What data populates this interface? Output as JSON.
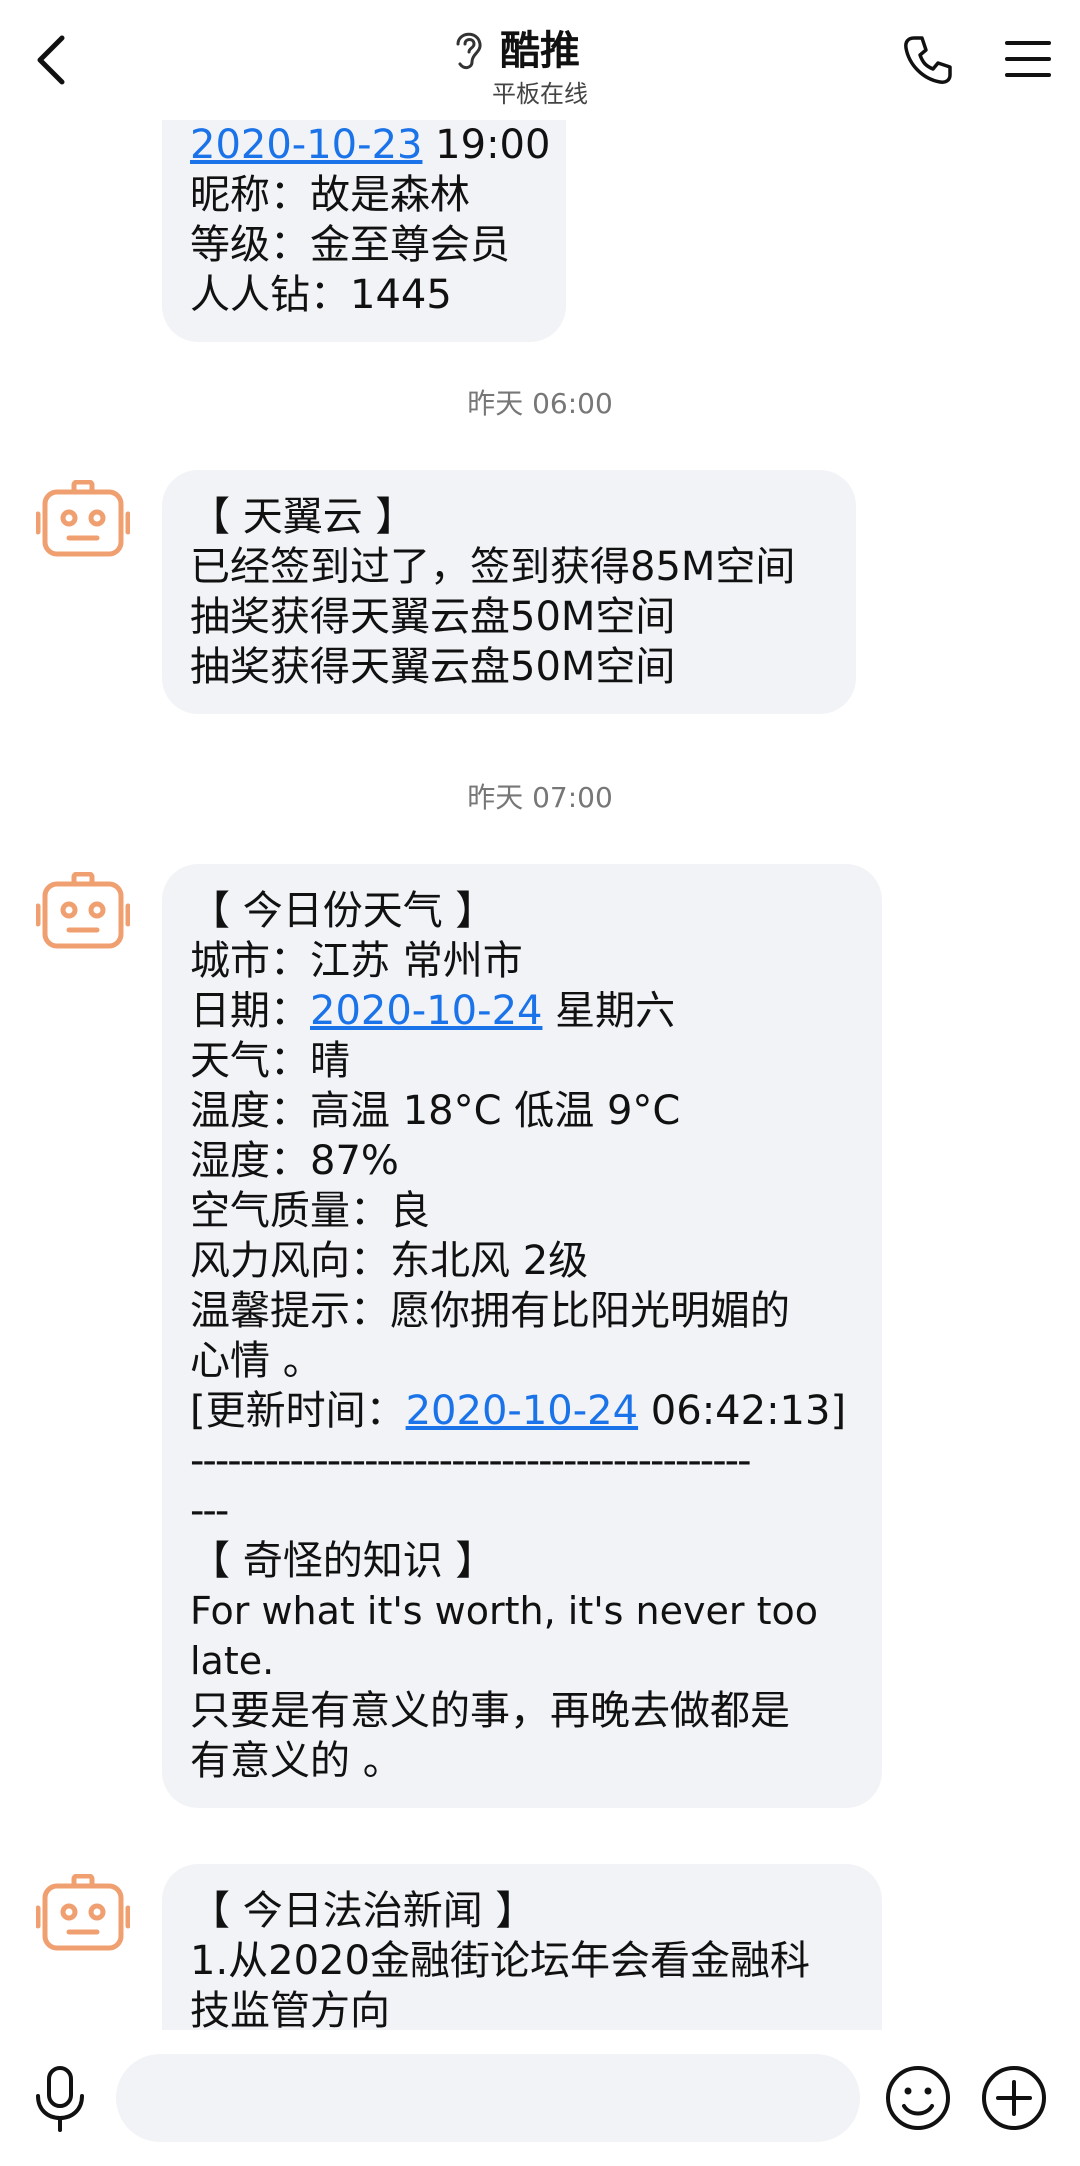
{
  "header": {
    "title": "酷推",
    "subtitle": "平板在线"
  },
  "messages": [
    {
      "lines_partial": [
        {
          "link": "2020-10-23",
          "text": " 19:00"
        },
        {
          "text": "昵称：故是森林"
        },
        {
          "text": "等级：金至尊会员"
        },
        {
          "text": "人人钻：1445"
        }
      ]
    }
  ],
  "timestamps": [
    "昨天 06:00",
    "昨天 07:00"
  ],
  "tianyi": {
    "line1": "【 天翼云 】",
    "line2": "已经签到过了，签到获得85M空间",
    "line3": "抽奖获得天翼云盘50M空间",
    "line4": "抽奖获得天翼云盘50M空间"
  },
  "weather": {
    "header": "【 今日份天气 】",
    "city": "城市：江苏 常州市",
    "date_prefix": "日期：",
    "date_link": "2020-10-24",
    "date_suffix": " 星期六",
    "weather": "天气：晴",
    "temp": "温度：高温 18°C 低温 9°C",
    "humidity": "湿度：87%",
    "air": "空气质量：良",
    "wind": "风力风向：东北风 2级",
    "tip1": "温馨提示：愿你拥有比阳光明媚的",
    "tip2": "心情 。",
    "update_prefix": "[更新时间：",
    "update_link": "2020-10-24",
    "update_suffix": " 06:42:13]",
    "dashes1": "---------------------------------------------",
    "dashes2": "---",
    "knowledge_header": "【 奇怪的知识 】",
    "en1": "For what it's worth, it's never too",
    "en2": "late.",
    "zh1": "只要是有意义的事，再晚去做都是",
    "zh2": "有意义的 。"
  },
  "news": {
    "header": "【 今日法治新闻 】",
    "item1a": "1.从2020金融街论坛年会看金融科",
    "item1b": "技监管方向"
  },
  "first_msg": {
    "date_link": "2020-10-23",
    "time": " 19:00",
    "nick": "昵称：故是森林",
    "level": "等级：金至尊会员",
    "diamond": "人人钻：1445"
  },
  "input": {
    "placeholder": ""
  },
  "colors": {
    "accent_link": "#1a73e8",
    "avatar_orange": "#f0a070",
    "bubble_bg": "#f2f3f7"
  },
  "icons": {
    "back": "chevron-left-icon",
    "ear": "ear-icon",
    "phone": "phone-icon",
    "menu": "menu-icon",
    "mic": "microphone-icon",
    "emoji": "smiley-icon",
    "plus": "plus-circle-icon",
    "avatar": "robot-avatar-icon"
  }
}
